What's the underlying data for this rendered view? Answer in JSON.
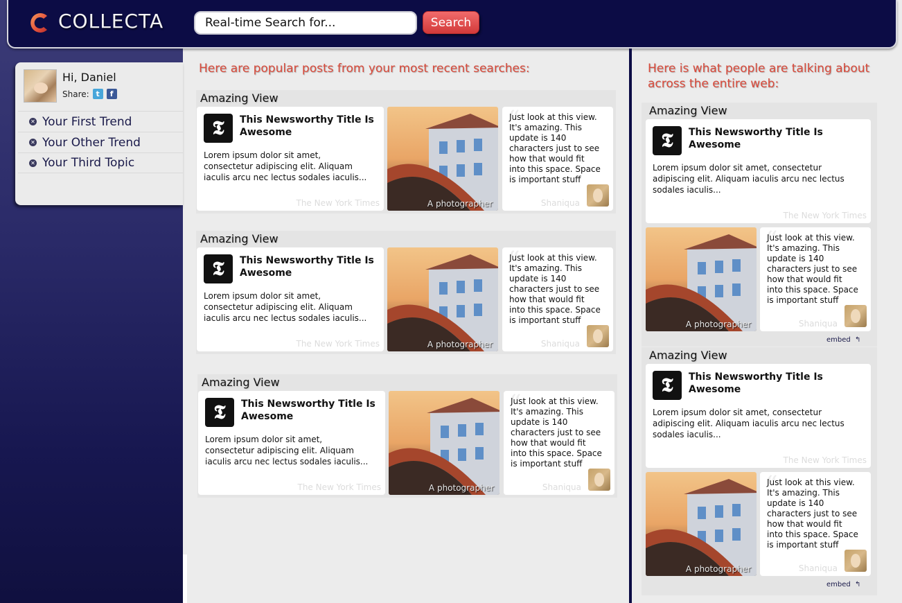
{
  "header": {
    "logo_text": "COLLECTA",
    "search_value": "Real-time Search for...",
    "search_button": "Search"
  },
  "profile": {
    "greeting": "Hi, Daniel",
    "share_label": "Share:",
    "trends": [
      "Your First Trend",
      "Your Other Trend",
      "Your Third Topic"
    ]
  },
  "main": {
    "heading": "Here are popular posts from your most recent searches:",
    "groups": [
      {
        "title": "Amazing View"
      },
      {
        "title": "Amazing View"
      },
      {
        "title": "Amazing View"
      }
    ]
  },
  "side": {
    "heading_line1": "Here is what people are talking about",
    "heading_line2": "across the entire web:",
    "groups": [
      {
        "title": "Amazing View",
        "embed": "embed"
      },
      {
        "title": "Amazing View",
        "embed": "embed"
      }
    ]
  },
  "post": {
    "news_title_line1": "This Newsworthy Title Is",
    "news_title_line2": "Awesome",
    "news_body_main": [
      "Lorem ipsum dolor sit amet,",
      "consectetur adipiscing elit. Aliquam",
      "iaculis arcu nec lectus sodales iaculis..."
    ],
    "news_body_side": [
      "Lorem ipsum dolor sit amet, consectetur",
      "adipiscing elit. Aliquam iaculis arcu nec lectus",
      "sodales iaculis..."
    ],
    "news_source": "The New York Times",
    "photo_caption": "A photographer",
    "quote_lines": [
      "Just look at this view.",
      "It's amazing. This",
      "update is 140",
      "characters just to see",
      "how that would fit",
      "into this space. Space",
      "is important stuff"
    ],
    "quote_author": "Shaniqua"
  },
  "colors": {
    "header_bg": "#0c0c45",
    "accent_red": "#d84a3b",
    "search_button": "#e04848"
  }
}
